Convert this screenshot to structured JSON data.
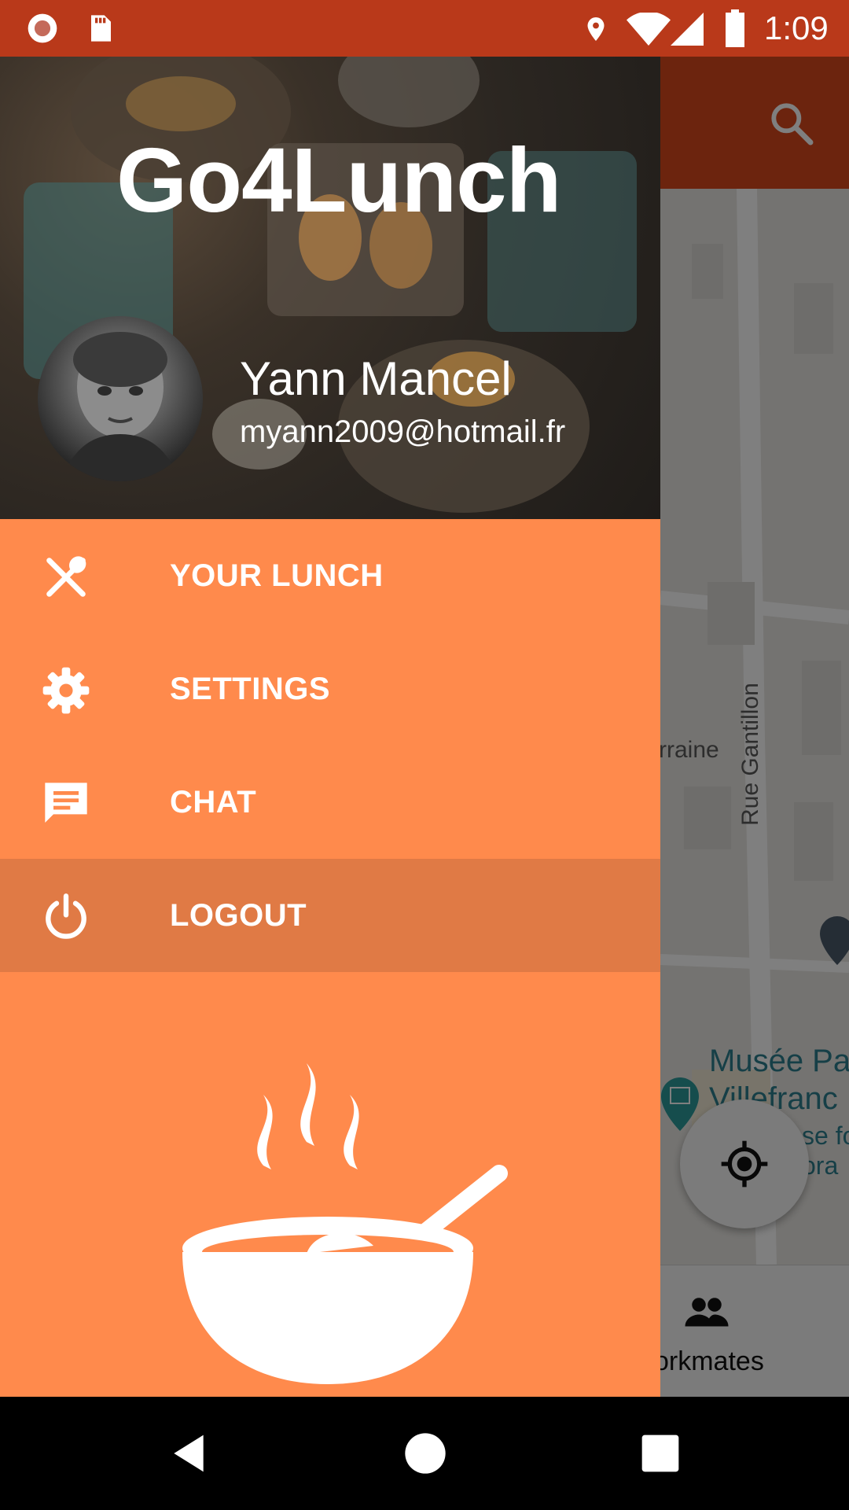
{
  "status_bar": {
    "time": "1:09",
    "icons": [
      "notification-icon",
      "sd-card-icon",
      "location-icon",
      "wifi-icon",
      "signal-icon",
      "battery-icon"
    ]
  },
  "toolbar": {
    "search_icon": "search-icon"
  },
  "map": {
    "street_label": "Rue Gantillon",
    "partial_label": "rraine",
    "museum_label_line1": "Musée Pa",
    "museum_label_line2": "Villefranc",
    "museum_sub_line1": "se fo",
    "museum_sub_line2": "ora",
    "locate_icon": "my-location-icon"
  },
  "bottom_nav": {
    "workmates_label": "orkmates",
    "workmates_icon": "people-icon"
  },
  "drawer": {
    "title": "Go4Lunch",
    "user_name": "Yann Mancel",
    "user_email": "myann2009@hotmail.fr",
    "items": [
      {
        "label": "YOUR LUNCH",
        "icon": "fork-spoon-icon"
      },
      {
        "label": "SETTINGS",
        "icon": "gear-icon"
      },
      {
        "label": "CHAT",
        "icon": "chat-icon"
      },
      {
        "label": "LOGOUT",
        "icon": "power-icon"
      }
    ],
    "illustration": "soup-bowl-icon"
  },
  "colors": {
    "drawer": "#ff8a4c",
    "drawer_selected": "#e07a45",
    "toolbar": "#d9481c",
    "status_bar": "#b9391a",
    "museum": "#2d7f8e"
  },
  "system_nav": {
    "icons": [
      "back-icon",
      "home-icon",
      "recents-icon"
    ]
  }
}
